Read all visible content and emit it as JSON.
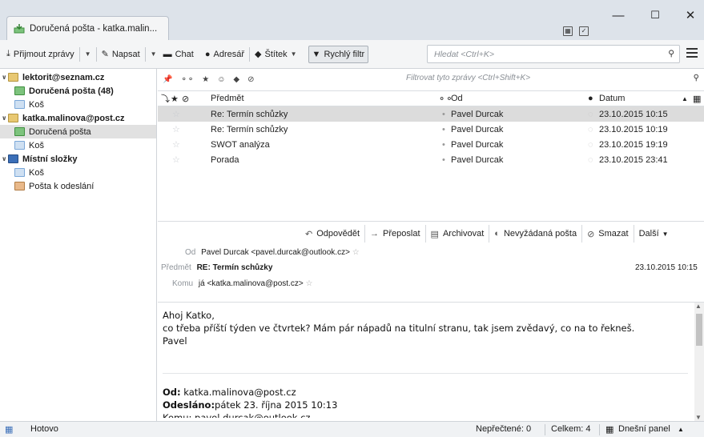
{
  "window": {
    "tab_title": "Doručená pošta - katka.malin...",
    "minimize": "—",
    "maximize": "☐",
    "close": "✕"
  },
  "toolbar": {
    "get_mail": "Přijmout zprávy",
    "compose": "Napsat",
    "chat": "Chat",
    "address_book": "Adresář",
    "tag": "Štítek",
    "quick_filter": "Rychlý filtr",
    "search_placeholder": "Hledat <Ctrl+K>"
  },
  "sidebar": {
    "items": [
      {
        "label": "lektorit@seznam.cz",
        "kind": "account"
      },
      {
        "label": "Doručená pošta (48)",
        "kind": "inbox"
      },
      {
        "label": "Koš",
        "kind": "trash"
      },
      {
        "label": "katka.malinova@post.cz",
        "kind": "account"
      },
      {
        "label": "Doručená pošta",
        "kind": "inbox"
      },
      {
        "label": "Koš",
        "kind": "trash"
      },
      {
        "label": "Místní složky",
        "kind": "local"
      },
      {
        "label": "Koš",
        "kind": "trash"
      },
      {
        "label": "Pošta k odeslání",
        "kind": "outbox"
      }
    ]
  },
  "message_list": {
    "filter_placeholder": "Filtrovat tyto zprávy <Ctrl+Shift+K>",
    "columns": {
      "subject": "Předmět",
      "from": "Od",
      "date": "Datum"
    },
    "rows": [
      {
        "subject": "Re: Termín schůzky",
        "from": "Pavel Durcak",
        "date": "23.10.2015 10:15"
      },
      {
        "subject": "Re: Termín schůzky",
        "from": "Pavel Durcak",
        "date": "23.10.2015 10:19"
      },
      {
        "subject": "SWOT analýza",
        "from": "Pavel Durcak",
        "date": "23.10.2015 19:19"
      },
      {
        "subject": "Porada",
        "from": "Pavel Durcak",
        "date": "23.10.2015 23:41"
      }
    ]
  },
  "message_header": {
    "actions": {
      "reply": "Odpovědět",
      "forward": "Přeposlat",
      "archive": "Archivovat",
      "junk": "Nevyžádaná pošta",
      "delete": "Smazat",
      "more": "Další"
    },
    "from_label": "Od",
    "from_value": "Pavel Durcak <pavel.durcak@outlook.cz>",
    "subject_label": "Předmět",
    "subject_value": "RE: Termín schůzky",
    "date_value": "23.10.2015 10:15",
    "to_label": "Komu",
    "to_value": "já <katka.malinova@post.cz>"
  },
  "message_body": {
    "line1": "Ahoj Katko,",
    "line2": "co třeba příští týden ve čtvrtek? Mám pár nápadů na titulní stranu, tak jsem zvědavý, co na to řekneš.",
    "line3": "Pavel",
    "quote_from_label": "Od:",
    "quote_from_value": " katka.malinova@post.cz",
    "quote_sent_label": "Odesláno:",
    "quote_sent_value": "pátek 23. října 2015 10:13",
    "quote_to_partial": "Komu: pavel.durcak@outlook.cz"
  },
  "status_bar": {
    "status": "Hotovo",
    "unread": "Nepřečtené: 0",
    "total": "Celkem: 4",
    "today_pane": "Dnešní panel"
  },
  "colors": {
    "titlebar": "#dde3ea",
    "selected_row": "#dcdcdc",
    "inbox_green": "#3f9f3f",
    "folder_blue": "#7aa7d8"
  }
}
